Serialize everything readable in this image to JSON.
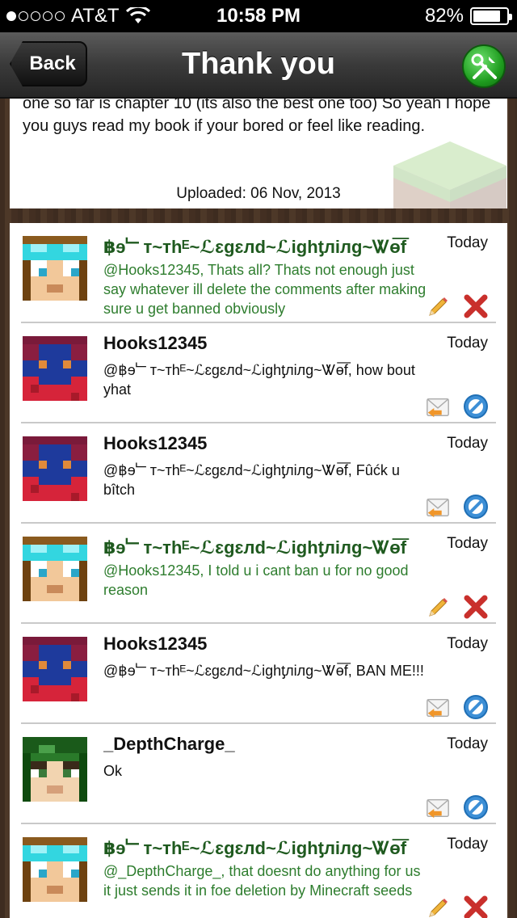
{
  "status_bar": {
    "carrier": "AT&T",
    "time": "10:58 PM",
    "battery": "82%",
    "battery_level": 0.82,
    "signal_bars": 1
  },
  "nav": {
    "back_label": "Back",
    "title": "Thank you",
    "tools_icon": "tools-icon"
  },
  "description": {
    "text": "one so far is chapter 10 (its also the best one too) So yeah I hope you guys read my book if your bored or feel like reading.",
    "uploaded": "Uploaded: 06 Nov, 2013"
  },
  "comments": [
    {
      "author": "฿ɘ﹂ᴛ~ᴛhᴱ~ℒɛgɛлd~ℒighƫлiлg~Ꮤɵ͞f",
      "time": "Today",
      "text": "@Hooks12345, Thats all? Thats not enough just say whatever ill delete the comments after making sure u get banned obviously",
      "style": "green",
      "actions": [
        "edit-icon",
        "delete-icon"
      ]
    },
    {
      "author": "Hooks12345",
      "time": "Today",
      "text": "@฿ɘ﹂ᴛ~ᴛhᴱ~ℒɛgɛлd~ℒighƫлiлg~Ꮤɵ͞f, how bout yhat",
      "style": "normal",
      "actions": [
        "reply-icon",
        "block-icon"
      ]
    },
    {
      "author": "Hooks12345",
      "time": "Today",
      "text": "@฿ɘ﹂ᴛ~ᴛhᴱ~ℒɛgɛлd~ℒighƫлiлg~Ꮤɵ͞f, Fûćk u bîtch",
      "style": "normal",
      "actions": [
        "reply-icon",
        "block-icon"
      ]
    },
    {
      "author": "฿ɘ﹂ᴛ~ᴛhᴱ~ℒɛgɛлd~ℒighƫлiлg~Ꮤɵ͞f",
      "time": "Today",
      "text": "@Hooks12345, I told u i cant ban u for no good reason",
      "style": "green",
      "actions": [
        "edit-icon",
        "delete-icon"
      ]
    },
    {
      "author": "Hooks12345",
      "time": "Today",
      "text": "@฿ɘ﹂ᴛ~ᴛhᴱ~ℒɛgɛлd~ℒighƫлiлg~Ꮤɵ͞f, BAN ME!!!",
      "style": "normal",
      "actions": [
        "reply-icon",
        "block-icon"
      ]
    },
    {
      "author": "_DepthCharge_",
      "time": "Today",
      "text": "Ok",
      "style": "normal",
      "actions": [
        "reply-icon",
        "block-icon"
      ]
    },
    {
      "author": "฿ɘ﹂ᴛ~ᴛhᴱ~ℒɛgɛлd~ℒighƫлiлg~Ꮤɵ͞f",
      "time": "Today",
      "text": "@_DepthCharge_, that doesnt do anything for us it just sends it in foe deletion by Minecraft seeds",
      "style": "green",
      "actions": [
        "edit-icon",
        "delete-icon"
      ]
    }
  ],
  "colors": {
    "green_author": "#1f5a1f",
    "green_text": "#2e7d2e",
    "tools_green": "#1f9d1f"
  }
}
